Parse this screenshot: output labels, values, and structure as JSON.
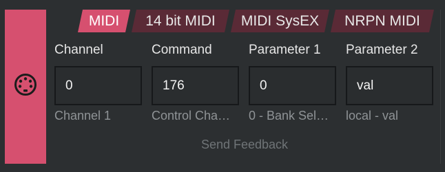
{
  "tabs": [
    {
      "label": "MIDI",
      "active": true
    },
    {
      "label": "14 bit MIDI",
      "active": false
    },
    {
      "label": "MIDI SysEX",
      "active": false
    },
    {
      "label": "NRPN MIDI",
      "active": false
    }
  ],
  "fields": [
    {
      "label": "Channel",
      "value": "0",
      "description": "Channel 1"
    },
    {
      "label": "Command",
      "value": "176",
      "description": "Control Cha…"
    },
    {
      "label": "Parameter 1",
      "value": "0",
      "description": "0 - Bank Sel…"
    },
    {
      "label": "Parameter 2",
      "value": "val",
      "description": "local - val"
    }
  ],
  "send_feedback_label": "Send Feedback",
  "side_icon": "midi-din-connector-icon",
  "colors": {
    "accent": "#d6506f",
    "tab_inactive": "#5a2a36",
    "background": "#2c2f31"
  }
}
